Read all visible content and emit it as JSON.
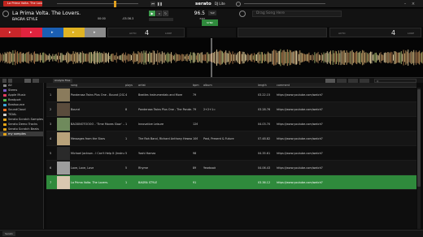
{
  "topbar": {
    "track_pill": "La Prima Volta. The Lovers.",
    "logo": "serato",
    "logo_sub": "DJ Lite"
  },
  "deck_left": {
    "title": "La Prima Volta. The Lovers.",
    "artist": "BAGRA STYLE",
    "bpm": "91.0",
    "time_elapsed": "00:00",
    "time_remaining": "-03:36.3"
  },
  "deck_center": {
    "bpm": "96.5",
    "bpm_suffix": "BPM",
    "tap_label": "TAP",
    "sync_label": "SYNC",
    "sync_time": "00:00.0"
  },
  "deck_right": {
    "placeholder": "Drag Song Here"
  },
  "beatstrip_left": {
    "value": "4",
    "left_label": "AUTO",
    "right_label": "LOOP"
  },
  "beatstrip_right": {
    "value": "4",
    "left_label": "AUTO",
    "right_label": "LOOP"
  },
  "pad_colors": [
    "#c9262a",
    "#e0233e",
    "#1b5fb3",
    "#e0b323",
    "#8b8b8b"
  ],
  "library": {
    "toolbar": {
      "tab_files": "Analyze Files",
      "search_placeholder": "Q"
    },
    "sidebar": [
      {
        "label": "All",
        "color": "#888888"
      },
      {
        "label": "Stems",
        "color": "#7a5cc7"
      },
      {
        "label": "Apple Music",
        "color": "#e33d5f"
      },
      {
        "label": "Beatport",
        "color": "#52c14b"
      },
      {
        "label": "Beatsource",
        "color": "#3aa3d9"
      },
      {
        "label": "SoundCloud",
        "color": "#f26f21"
      },
      {
        "label": "TIDAL",
        "color": "#cfcfcf"
      },
      {
        "label": "Serato Scratch Samples",
        "color": "#e3a317"
      },
      {
        "label": "Serato Demo Tracks",
        "color": "#e3a317"
      },
      {
        "label": "Serato Scratch Beats",
        "color": "#e3a317"
      },
      {
        "label": "my samples",
        "color": "#e3a317"
      }
    ],
    "columns": {
      "song": "song",
      "plays": "plays",
      "artist": "artist",
      "bpm": "bpm",
      "album": "album",
      "length": "length",
      "comment": "comment"
    },
    "rows": [
      {
        "num": "1",
        "song": "Ponderosa Twins Plus One - Bound (2024 ...",
        "plays": "4",
        "artist": "Beatles Instrumentals and More",
        "bpm": "79",
        "album": "",
        "length": "03.22.15",
        "comment": "https://www.youtube.com/watch?",
        "thumb": "#8a7b5c"
      },
      {
        "num": "2",
        "song": "Bound",
        "plays": "8",
        "artist": "Ponderosa Twins Plus One - The Ponde...",
        "bpm": "79",
        "album": "2+2+1=",
        "length": "03.28.76",
        "comment": "https://www.youtube.com/watch?",
        "thumb": "#5a4b3c"
      },
      {
        "num": "3",
        "song": "BACKINOTOOOO - 'Time Moves Slow' ...",
        "plays": "1",
        "artist": "Innovative Leisure",
        "bpm": "126",
        "album": "",
        "length": "04.03.70",
        "comment": "https://www.youtube.com/watch?",
        "thumb": "#6f8a5c"
      },
      {
        "num": "4",
        "song": "Messages from the Stars",
        "plays": "1",
        "artist": "The Rah Band, Richard Anthony Hewson...",
        "bpm": "106",
        "album": "Past, Present & Future",
        "length": "07.48.82",
        "comment": "https://www.youtube.com/watch?",
        "thumb": "#b8a27a"
      },
      {
        "num": "5",
        "song": "Michael Jackson - I Can't Help It (Instrume...",
        "plays": "5",
        "artist": "Yoshi Hamas",
        "bpm": "98",
        "album": "",
        "length": "04.35.61",
        "comment": "https://www.youtube.com/watch?",
        "thumb": "#2a2a2a"
      },
      {
        "num": "6",
        "song": "Love, Love, Love",
        "plays": "5",
        "artist": "Rhyme",
        "bpm": "89",
        "album": "Yearbook",
        "length": "04.06.43",
        "comment": "https://www.youtube.com/watch?",
        "thumb": "#9c9c9c"
      },
      {
        "num": "7",
        "song": "La Prima Volta. The Lovers.",
        "plays": "1",
        "artist": "BAGRA STYLE",
        "bpm": "91",
        "album": "",
        "length": "03.36.12",
        "comment": "https://www.youtube.com/watch?",
        "thumb": "#d9c7b0"
      }
    ]
  },
  "bottombar": {
    "label": "Serato"
  }
}
